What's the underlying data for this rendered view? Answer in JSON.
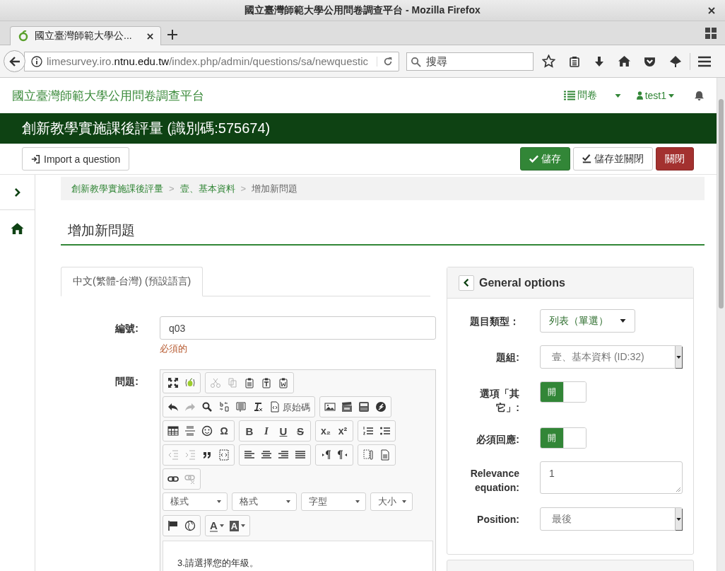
{
  "window": {
    "title": "國立臺灣師範大學公用問卷調查平台 - Mozilla Firefox"
  },
  "browser_tabs": [
    {
      "label": "國立臺灣師範大學公...",
      "selected": true
    }
  ],
  "address_bar": {
    "url_start": "limesurvey.iro.",
    "url_domain": "ntnu.edu.tw",
    "url_end": "/index.php/admin/questions/sa/newquestic"
  },
  "search": {
    "placeholder": "搜尋"
  },
  "site_header": {
    "title": "國立臺灣師範大學公用問卷調查平台",
    "menu": "問卷",
    "user": "test1"
  },
  "survey_title": "創新教學實施課後評量 (識別碼:575674)",
  "actions": [
    {
      "kind": "import",
      "label": "Import a question"
    },
    {
      "kind": "save",
      "label": "儲存"
    },
    {
      "kind": "save-close",
      "label": "儲存並關閉"
    },
    {
      "kind": "close",
      "label": "關閉"
    }
  ],
  "breadcrumb": [
    {
      "kind": "link",
      "label": "創新教學實施課後評量"
    },
    {
      "kind": "sep",
      "label": ">"
    },
    {
      "kind": "link",
      "label": "壹、基本資料"
    },
    {
      "kind": "sep",
      "label": ">"
    },
    {
      "kind": "current",
      "label": "增加新問題"
    }
  ],
  "page_heading": "增加新問題",
  "language_tabs": [
    {
      "label": "中文(繁體-台灣) (預設語言)",
      "selected": true
    }
  ],
  "code_field": {
    "label": "編號:",
    "value": "q03",
    "error": "必須的"
  },
  "question_field": {
    "label": "問題:",
    "content": "3.請選擇您的年級。"
  },
  "editor_toolbar": [
    {
      "kind": "buttons",
      "groups": [
        [
          {
            "kind": "icon",
            "disabled": false
          },
          {
            "kind": "icon",
            "disabled": false
          }
        ],
        [
          {
            "kind": "icon",
            "disabled": true
          },
          {
            "kind": "icon",
            "disabled": true
          },
          {
            "kind": "icon",
            "disabled": false
          },
          {
            "kind": "icon",
            "disabled": false
          },
          {
            "kind": "icon",
            "disabled": false
          }
        ]
      ]
    },
    {
      "kind": "buttons",
      "groups": [
        [
          {
            "kind": "icon",
            "disabled": false
          },
          {
            "kind": "icon",
            "disabled": true
          },
          {
            "kind": "icon",
            "disabled": false
          },
          {
            "kind": "icon",
            "disabled": false
          },
          {
            "kind": "icon",
            "disabled": false
          },
          {
            "kind": "icon",
            "disabled": false
          },
          {
            "kind": "source",
            "label": "原始碼",
            "disabled": false
          }
        ],
        [
          {
            "kind": "icon",
            "disabled": false
          },
          {
            "kind": "icon",
            "disabled": false
          },
          {
            "kind": "icon",
            "disabled": false
          },
          {
            "kind": "icon",
            "disabled": false
          }
        ]
      ]
    },
    {
      "kind": "buttons",
      "groups": [
        [
          {
            "kind": "icon",
            "disabled": false
          },
          {
            "kind": "icon",
            "disabled": false
          },
          {
            "kind": "icon",
            "disabled": false
          },
          {
            "kind": "symbol",
            "label": "Ω",
            "disabled": false
          }
        ],
        [
          {
            "kind": "bold",
            "label": "B",
            "disabled": false
          },
          {
            "kind": "italic",
            "label": "I",
            "disabled": false
          },
          {
            "kind": "underline",
            "label": "U",
            "disabled": false
          },
          {
            "kind": "strike",
            "label": "S",
            "disabled": false
          }
        ],
        [
          {
            "kind": "symbol",
            "label": "x₂",
            "disabled": false
          },
          {
            "kind": "symbol",
            "label": "x²",
            "disabled": false
          }
        ],
        [
          {
            "kind": "icon",
            "disabled": false
          },
          {
            "kind": "icon",
            "disabled": false
          }
        ]
      ]
    },
    {
      "kind": "buttons",
      "groups": [
        [
          {
            "kind": "icon",
            "disabled": true
          },
          {
            "kind": "icon",
            "disabled": true
          },
          {
            "kind": "icon",
            "disabled": false
          },
          {
            "kind": "icon",
            "disabled": false
          }
        ],
        [
          {
            "kind": "icon",
            "disabled": false
          },
          {
            "kind": "icon",
            "disabled": false
          },
          {
            "kind": "icon",
            "disabled": false
          },
          {
            "kind": "icon",
            "disabled": false
          }
        ],
        [
          {
            "kind": "icon",
            "disabled": false
          },
          {
            "kind": "icon",
            "disabled": false
          }
        ],
        [
          {
            "kind": "icon",
            "disabled": false
          },
          {
            "kind": "icon",
            "disabled": false
          }
        ]
      ]
    },
    {
      "kind": "buttons",
      "groups": [
        [
          {
            "kind": "icon",
            "disabled": false
          },
          {
            "kind": "icon",
            "disabled": true
          }
        ]
      ]
    },
    {
      "kind": "combos",
      "items": [
        {
          "label": "樣式"
        },
        {
          "label": "格式"
        },
        {
          "label": "字型"
        },
        {
          "label": "大小"
        }
      ]
    },
    {
      "kind": "buttons",
      "groups": [
        [
          {
            "kind": "icon",
            "disabled": false
          },
          {
            "kind": "icon",
            "disabled": false
          }
        ],
        [
          {
            "kind": "text-color",
            "label": "A",
            "disabled": false
          },
          {
            "kind": "bg-color",
            "label": "A",
            "disabled": false
          }
        ]
      ]
    }
  ],
  "general_options": {
    "title": "General options",
    "rows": [
      {
        "kind": "dropdown",
        "label": "題目類型：",
        "value": "列表（單選）"
      },
      {
        "kind": "select",
        "label": "題組:",
        "value": "壹、基本資料 (ID:32)"
      },
      {
        "kind": "switch",
        "label": "選項「其它」:",
        "on": true,
        "on_label": "開"
      },
      {
        "kind": "switch",
        "label": "必須回應:",
        "on": true,
        "on_label": "開"
      },
      {
        "kind": "textarea",
        "label": "Relevance equation:",
        "value": "1"
      },
      {
        "kind": "select",
        "label": "Position:",
        "value": "最後"
      }
    ]
  }
}
